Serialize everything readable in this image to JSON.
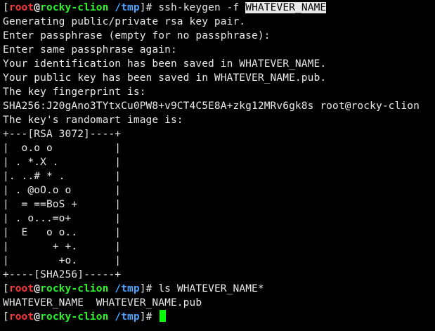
{
  "prompt": {
    "open": "[",
    "user": "root",
    "at": "@",
    "host": "rocky-clion",
    "dir": "/tmp",
    "close": "]",
    "symbol": "# "
  },
  "session": [
    {
      "kind": "command",
      "command": "ssh-keygen -f ",
      "selected": "WHATEVER_NAME"
    },
    {
      "kind": "output",
      "text": "Generating public/private rsa key pair."
    },
    {
      "kind": "output",
      "text": "Enter passphrase (empty for no passphrase):"
    },
    {
      "kind": "output",
      "text": "Enter same passphrase again:"
    },
    {
      "kind": "output",
      "text": "Your identification has been saved in WHATEVER_NAME."
    },
    {
      "kind": "output",
      "text": "Your public key has been saved in WHATEVER_NAME.pub."
    },
    {
      "kind": "output",
      "text": "The key fingerprint is:"
    },
    {
      "kind": "output",
      "text": "SHA256:J20gAno3TYtxCu0PW8+v9CT4C5E8A+zkg12MRv6gk8s root@rocky-clion"
    },
    {
      "kind": "output",
      "text": "The key's randomart image is:"
    },
    {
      "kind": "output",
      "text": "+---[RSA 3072]----+"
    },
    {
      "kind": "output",
      "text": "|  o.o o          |"
    },
    {
      "kind": "output",
      "text": "| . *.X .         |"
    },
    {
      "kind": "output",
      "text": "|. ..# * .        |"
    },
    {
      "kind": "output",
      "text": "| . @oO.o o       |"
    },
    {
      "kind": "output",
      "text": "|  = ==BoS +      |"
    },
    {
      "kind": "output",
      "text": "| . o...=o+       |"
    },
    {
      "kind": "output",
      "text": "|  E   o o..      |"
    },
    {
      "kind": "output",
      "text": "|       + +.      |"
    },
    {
      "kind": "output",
      "text": "|        +o.      |"
    },
    {
      "kind": "output",
      "text": "+----[SHA256]-----+"
    },
    {
      "kind": "command",
      "command": "ls WHATEVER_NAME*"
    },
    {
      "kind": "output",
      "text": "WHATEVER_NAME  WHATEVER_NAME.pub"
    },
    {
      "kind": "command",
      "command": "",
      "cursor": true
    }
  ],
  "colors": {
    "background": "#000000",
    "text": "#e8e8e8",
    "prompt_user": "#ff3b3b",
    "prompt_host": "#2ef52e",
    "prompt_dir": "#4fa3ff",
    "selection_background": "#e9e9e9",
    "cursor": "#00ff00"
  }
}
